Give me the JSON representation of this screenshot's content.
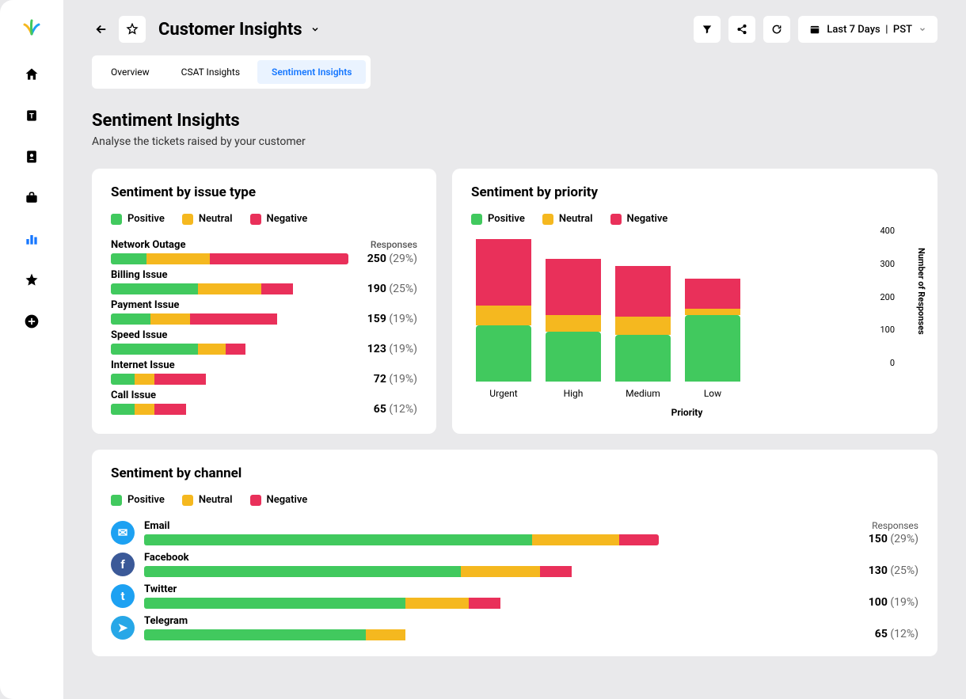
{
  "colors": {
    "positive": "#41c95e",
    "neutral": "#f5b81f",
    "negative": "#e9305a",
    "accent": "#1677ff"
  },
  "sidebar": {
    "items": [
      "home",
      "text",
      "contact",
      "briefcase",
      "chart",
      "star",
      "add"
    ],
    "active_index": 4
  },
  "header": {
    "title": "Customer Insights",
    "date_range": "Last 7 Days",
    "timezone": "PST"
  },
  "tabs": [
    {
      "label": "Overview"
    },
    {
      "label": "CSAT Insights"
    },
    {
      "label": "Sentiment Insights"
    }
  ],
  "tabs_active_index": 2,
  "section": {
    "title": "Sentiment Insights",
    "subtitle": "Analyse the tickets raised by your customer"
  },
  "legend": {
    "positive": "Positive",
    "neutral": "Neutral",
    "negative": "Negative"
  },
  "responses_label": "Responses",
  "issue_card": {
    "title": "Sentiment by issue type",
    "rows": [
      {
        "name": "Network Outage",
        "count": 250,
        "pct": "29%",
        "pos": 45,
        "neu": 80,
        "neg": 175
      },
      {
        "name": "Billing Issue",
        "count": 190,
        "pct": "25%",
        "pos": 110,
        "neu": 80,
        "neg": 40
      },
      {
        "name": "Payment Issue",
        "count": 159,
        "pct": "19%",
        "pos": 50,
        "neu": 50,
        "neg": 110
      },
      {
        "name": "Speed Issue",
        "count": 123,
        "pct": "19%",
        "pos": 110,
        "neu": 35,
        "neg": 25
      },
      {
        "name": "Internet Issue",
        "count": 72,
        "pct": "19%",
        "pos": 30,
        "neu": 25,
        "neg": 65
      },
      {
        "name": "Call Issue",
        "count": 65,
        "pct": "12%",
        "pos": 30,
        "neu": 25,
        "neg": 40
      }
    ]
  },
  "priority_card": {
    "title": "Sentiment by priority",
    "x_label": "Priority",
    "y_label": "Number of Responses",
    "y_ticks": [
      "400",
      "300",
      "200",
      "100",
      "0"
    ],
    "categories": [
      "Urgent",
      "High",
      "Medium",
      "Low"
    ]
  },
  "channel_card": {
    "title": "Sentiment by channel",
    "rows": [
      {
        "name": "Email",
        "count": 150,
        "pct": "29%",
        "pos": 490,
        "neu": 110,
        "neg": 50,
        "icon_bg": "#1da1f2",
        "glyph": "✉"
      },
      {
        "name": "Facebook",
        "count": 130,
        "pct": "25%",
        "pos": 400,
        "neu": 100,
        "neg": 40,
        "icon_bg": "#3b5998",
        "glyph": "f"
      },
      {
        "name": "Twitter",
        "count": 100,
        "pct": "19%",
        "pos": 330,
        "neu": 80,
        "neg": 40,
        "icon_bg": "#1da1f2",
        "glyph": "t"
      },
      {
        "name": "Telegram",
        "count": 65,
        "pct": "12%",
        "pos": 280,
        "neu": 50,
        "neg": 0,
        "icon_bg": "#27a7e7",
        "glyph": "➤"
      }
    ]
  },
  "chart_data": {
    "type": "bar",
    "stacked": true,
    "title": "Sentiment by priority",
    "xlabel": "Priority",
    "ylabel": "Number of Responses",
    "ylim": [
      0,
      430
    ],
    "categories": [
      "Urgent",
      "High",
      "Medium",
      "Low"
    ],
    "series": [
      {
        "name": "Positive",
        "values": [
          170,
          150,
          140,
          200
        ],
        "color": "#41c95e"
      },
      {
        "name": "Neutral",
        "values": [
          60,
          50,
          55,
          20
        ],
        "color": "#f5b81f"
      },
      {
        "name": "Negative",
        "values": [
          200,
          170,
          155,
          90
        ],
        "color": "#e9305a"
      }
    ]
  }
}
